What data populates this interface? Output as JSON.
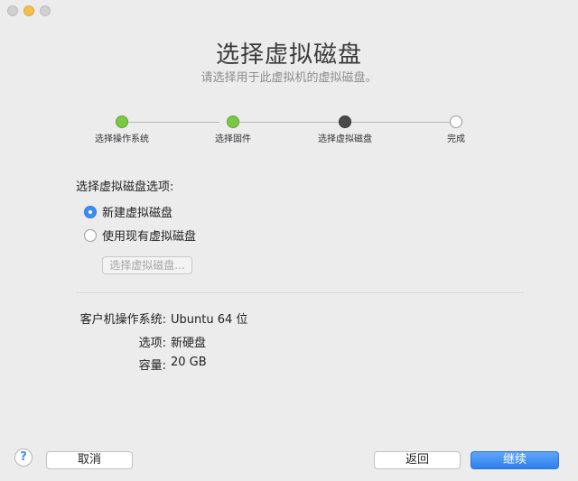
{
  "window": {
    "title": "选择虚拟磁盘",
    "subtitle": "请选择用于此虚拟机的虚拟磁盘。"
  },
  "stepper": {
    "steps": [
      {
        "label": "选择操作系统",
        "state": "done"
      },
      {
        "label": "选择固件",
        "state": "done"
      },
      {
        "label": "选择虚拟磁盘",
        "state": "current"
      },
      {
        "label": "完成",
        "state": "todo"
      }
    ]
  },
  "options": {
    "label": "选择虚拟磁盘选项:",
    "radio_new": "新建虚拟磁盘",
    "radio_existing": "使用现有虚拟磁盘",
    "choose_button": "选择虚拟磁盘..."
  },
  "summary": {
    "os_key": "客户机操作系统:",
    "os_val": "Ubuntu 64 位",
    "option_key": "选项:",
    "option_val": "新硬盘",
    "capacity_key": "容量:",
    "capacity_val": "20 GB"
  },
  "footer": {
    "help": "?",
    "cancel": "取消",
    "back": "返回",
    "continue": "继续"
  },
  "colors": {
    "accent": "#3d8df5",
    "done": "#7ac943",
    "current": "#4a4a4a"
  }
}
